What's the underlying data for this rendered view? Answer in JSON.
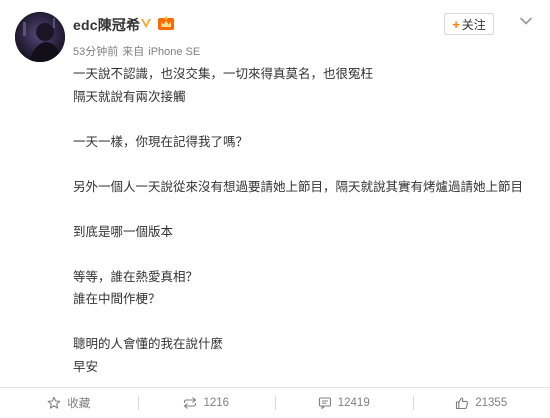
{
  "post": {
    "username": "edc陳冠希",
    "meta": {
      "time": "53分钟前",
      "source_prefix": "来自",
      "source": "iPhone SE"
    },
    "follow_label": "关注",
    "content": [
      "一天說不認識，也沒交集，一切來得真莫名，也很冤枉",
      "隔天就說有兩次接觸",
      "",
      "一天一樣，你現在記得我了嗎？",
      "",
      "另外一個人一天說從來沒有想過要請她上節目，隔天就說其實有烤爐過請她上節目",
      "",
      "到底是哪一個版本",
      "",
      "等等，誰在熱愛真相？",
      "誰在中間作梗？",
      "",
      "聰明的人會懂的我在說什麼",
      "早安"
    ]
  },
  "actions": {
    "favorite_label": "收藏",
    "repost_count": "1216",
    "comment_count": "12419",
    "like_count": "21355"
  },
  "icons": {
    "verified": "verified-badge-icon",
    "vip": "vip-crown-icon",
    "menu": "chevron-down-icon",
    "favorite": "star-icon",
    "repost": "repost-icon",
    "comment": "comment-icon",
    "like": "thumbs-up-icon"
  },
  "colors": {
    "accent": "#ff8200",
    "text": "#333333",
    "muted": "#808080"
  }
}
